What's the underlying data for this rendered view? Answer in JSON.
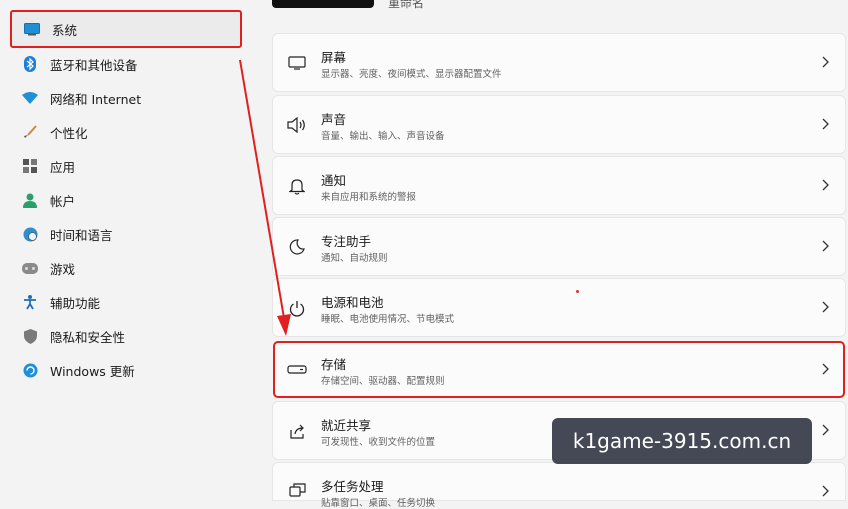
{
  "header": {
    "title_partial": "重命名"
  },
  "sidebar": {
    "items": [
      {
        "label": "系统",
        "icon": "monitor-icon"
      },
      {
        "label": "蓝牙和其他设备",
        "icon": "bluetooth-icon"
      },
      {
        "label": "网络和 Internet",
        "icon": "wifi-icon"
      },
      {
        "label": "个性化",
        "icon": "brush-icon"
      },
      {
        "label": "应用",
        "icon": "apps-icon"
      },
      {
        "label": "帐户",
        "icon": "person-icon"
      },
      {
        "label": "时间和语言",
        "icon": "globe-clock-icon"
      },
      {
        "label": "游戏",
        "icon": "gamepad-icon"
      },
      {
        "label": "辅助功能",
        "icon": "accessibility-icon"
      },
      {
        "label": "隐私和安全性",
        "icon": "shield-icon"
      },
      {
        "label": "Windows 更新",
        "icon": "update-icon"
      }
    ]
  },
  "settings": {
    "cards": [
      {
        "title": "屏幕",
        "subtitle": "显示器、亮度、夜间模式、显示器配置文件",
        "icon": "display-icon"
      },
      {
        "title": "声音",
        "subtitle": "音量、输出、输入、声音设备",
        "icon": "speaker-icon"
      },
      {
        "title": "通知",
        "subtitle": "来自应用和系统的警报",
        "icon": "bell-icon"
      },
      {
        "title": "专注助手",
        "subtitle": "通知、自动规则",
        "icon": "moon-icon"
      },
      {
        "title": "电源和电池",
        "subtitle": "睡眠、电池使用情况、节电模式",
        "icon": "power-icon"
      },
      {
        "title": "存储",
        "subtitle": "存储空间、驱动器、配置规则",
        "icon": "storage-icon"
      },
      {
        "title": "就近共享",
        "subtitle": "可发现性、收到文件的位置",
        "icon": "share-icon"
      },
      {
        "title": "多任务处理",
        "subtitle": "贴靠窗口、桌面、任务切换",
        "icon": "multitask-icon"
      }
    ]
  },
  "watermark": {
    "text": "k1game-3915.com.cn"
  },
  "colors": {
    "highlight": "#e02020",
    "accent": "#0067c0"
  }
}
